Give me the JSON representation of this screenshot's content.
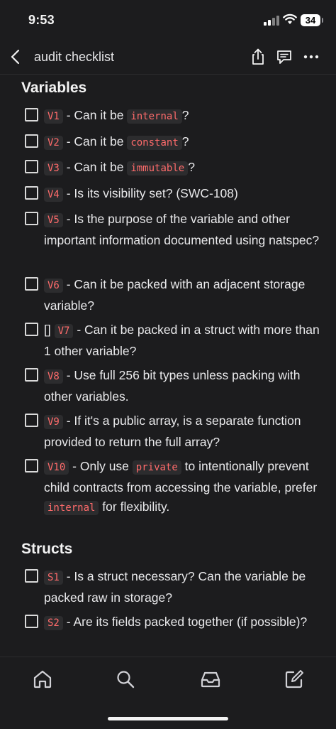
{
  "status": {
    "time": "9:53",
    "battery": "34"
  },
  "nav": {
    "title": "audit checklist"
  },
  "sections": {
    "variables": {
      "title": "Variables",
      "items": [
        {
          "code": "V1",
          "parts": [
            " - Can it be ",
            "internal",
            "?"
          ]
        },
        {
          "code": "V2",
          "parts": [
            " - Can it be ",
            "constant",
            "?"
          ]
        },
        {
          "code": "V3",
          "parts": [
            " - Can it be ",
            "immutable",
            "?"
          ]
        },
        {
          "code": "V4",
          "text": " - Is its visibility set? (SWC-108)"
        },
        {
          "code": "V5",
          "text": " - Is the purpose of the variable and other important information documented using natspec?"
        },
        {
          "code": "V6",
          "text": " - Can it be packed with an adjacent storage variable?"
        },
        {
          "prefix": "[] ",
          "code": "V7",
          "text": " - Can it be packed in a struct with more than 1 other variable?"
        },
        {
          "code": "V8",
          "text": " - Use full 256 bit types unless packing with other variables."
        },
        {
          "code": "V9",
          "text": " - If it's a public array, is a separate function provided to return the full array?"
        },
        {
          "code": "V10",
          "parts": [
            " - Only use ",
            "private",
            " to intentionally prevent child contracts from accessing the variable, prefer ",
            "internal",
            " for flexibility."
          ]
        }
      ]
    },
    "structs": {
      "title": "Structs",
      "items": [
        {
          "code": "S1",
          "text": " - Is a struct necessary? Can the variable be packed raw in storage?"
        },
        {
          "code": "S2",
          "text": " - Are its fields packed together (if possible)?"
        }
      ]
    }
  },
  "icons": {
    "nav": [
      "back-chevron-icon",
      "share-icon",
      "comment-icon",
      "more-icon"
    ],
    "tabs": [
      "home-icon",
      "search-icon",
      "inbox-icon",
      "compose-icon"
    ]
  },
  "colors": {
    "background": "#1c1c1e",
    "code_text": "#ff6b6b",
    "code_bg": "#2c2c2e"
  }
}
